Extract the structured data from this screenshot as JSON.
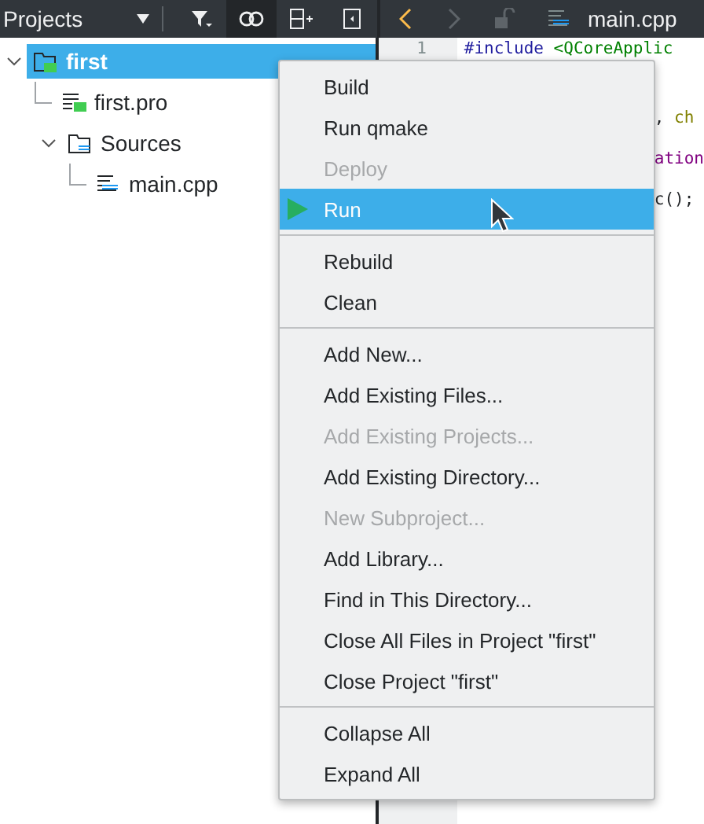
{
  "projects_toolbar": {
    "title": "Projects",
    "tools": [
      {
        "kind": "filter",
        "on": false
      },
      {
        "kind": "link",
        "on": true
      },
      {
        "kind": "split",
        "on": false
      },
      {
        "kind": "close-pane",
        "on": false
      }
    ]
  },
  "editor_toolbar": {
    "nav": [
      {
        "kind": "back",
        "disabled": false
      },
      {
        "kind": "forward",
        "disabled": true
      }
    ],
    "file_name": "main.cpp"
  },
  "tree": [
    {
      "label": "first",
      "kind": "project",
      "selected": true,
      "expanded": true,
      "children": [
        {
          "label": "first.pro",
          "kind": "pro",
          "selected": false
        },
        {
          "label": "Sources",
          "kind": "folder",
          "selected": false,
          "expanded": true,
          "children": [
            {
              "label": "main.cpp",
              "kind": "cpp",
              "selected": false
            }
          ]
        }
      ]
    }
  ],
  "editor": {
    "line_numbers": [
      "1"
    ],
    "lines": [
      {
        "kind": "full",
        "segments": [
          {
            "text": "#include ",
            "color": "#1f1c9e"
          },
          {
            "text": "<QCoreApplic",
            "color": "#008000"
          }
        ]
      },
      {
        "kind": "tail",
        "segments": [
          {
            "text": ", ",
            "color": "#232629"
          },
          {
            "text": "ch",
            "color": "#808000"
          }
        ]
      },
      {
        "kind": "tail",
        "segments": [
          {
            "text": "ation",
            "color": "#800080"
          }
        ]
      },
      {
        "kind": "tail",
        "segments": [
          {
            "text": "c();",
            "color": "#232629"
          }
        ]
      }
    ]
  },
  "context_menu": {
    "items": [
      {
        "kind": "item",
        "label": "Build",
        "disabled": false,
        "selected": false
      },
      {
        "kind": "item",
        "label": "Run qmake",
        "disabled": false,
        "selected": false
      },
      {
        "kind": "item",
        "label": "Deploy",
        "disabled": true,
        "selected": false
      },
      {
        "kind": "icon-item",
        "label": "Run",
        "disabled": false,
        "selected": true
      },
      {
        "kind": "separator"
      },
      {
        "kind": "item",
        "label": "Rebuild",
        "disabled": false,
        "selected": false
      },
      {
        "kind": "item",
        "label": "Clean",
        "disabled": false,
        "selected": false
      },
      {
        "kind": "separator"
      },
      {
        "kind": "item",
        "label": "Add New...",
        "disabled": false,
        "selected": false
      },
      {
        "kind": "item",
        "label": "Add Existing Files...",
        "disabled": false,
        "selected": false
      },
      {
        "kind": "item",
        "label": "Add Existing Projects...",
        "disabled": true,
        "selected": false
      },
      {
        "kind": "item",
        "label": "Add Existing Directory...",
        "disabled": false,
        "selected": false
      },
      {
        "kind": "item",
        "label": "New Subproject...",
        "disabled": true,
        "selected": false
      },
      {
        "kind": "item",
        "label": "Add Library...",
        "disabled": false,
        "selected": false
      },
      {
        "kind": "item",
        "label": "Find in This Directory...",
        "disabled": false,
        "selected": false
      },
      {
        "kind": "item",
        "label": "Close All Files in Project \"first\"",
        "disabled": false,
        "selected": false
      },
      {
        "kind": "item",
        "label": "Close Project \"first\"",
        "disabled": false,
        "selected": false
      },
      {
        "kind": "separator"
      },
      {
        "kind": "item",
        "label": "Collapse All",
        "disabled": false,
        "selected": false
      },
      {
        "kind": "item",
        "label": "Expand All",
        "disabled": false,
        "selected": false
      }
    ]
  }
}
